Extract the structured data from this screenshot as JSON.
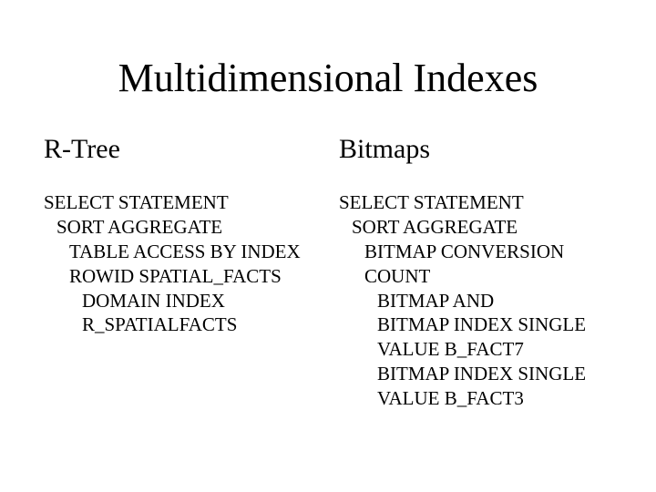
{
  "title": "Multidimensional Indexes",
  "left": {
    "heading": "R-Tree",
    "lines": {
      "l0": "SELECT STATEMENT",
      "l1": "SORT AGGREGATE",
      "l2": "TABLE ACCESS BY INDEX ROWID SPATIAL_FACTS",
      "l3": "DOMAIN INDEX R_SPATIALFACTS"
    }
  },
  "right": {
    "heading": "Bitmaps",
    "lines": {
      "l0": "SELECT  STATEMENT",
      "l1": "SORT AGGREGATE",
      "l2": "BITMAP CONVERSION COUNT",
      "l3": "BITMAP AND",
      "l4": "BITMAP INDEX SINGLE VALUE B_FACT7",
      "l5": "BITMAP INDEX SINGLE VALUE B_FACT3"
    }
  }
}
